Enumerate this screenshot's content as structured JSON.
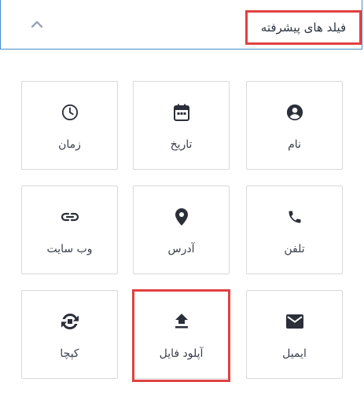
{
  "header": {
    "title": "فیلد های پیشرفته",
    "collapse_icon": "chevron-up-icon"
  },
  "fields": [
    {
      "label": "نام",
      "icon": "account-circle-icon"
    },
    {
      "label": "تاریخ",
      "icon": "calendar-icon"
    },
    {
      "label": "زمان",
      "icon": "clock-icon"
    },
    {
      "label": "تلفن",
      "icon": "phone-icon"
    },
    {
      "label": "آدرس",
      "icon": "location-pin-icon"
    },
    {
      "label": "وب سایت",
      "icon": "link-icon"
    },
    {
      "label": "ایمیل",
      "icon": "email-icon"
    },
    {
      "label": "آپلود فایل",
      "icon": "upload-icon"
    },
    {
      "label": "کپچا",
      "icon": "captcha-icon"
    }
  ],
  "colors": {
    "accent_border": "#4a8ec7",
    "highlight": "#e14141",
    "icon": "#2b2f3a"
  }
}
